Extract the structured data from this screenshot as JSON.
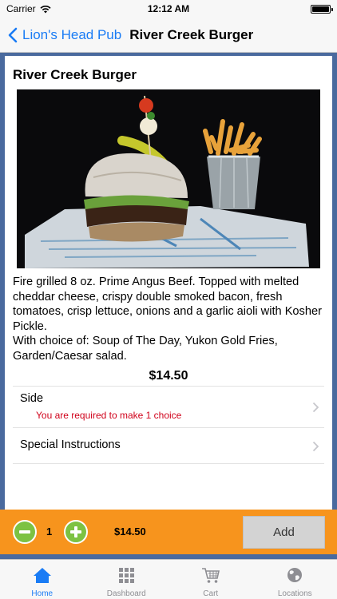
{
  "status_bar": {
    "carrier": "Carrier",
    "time": "12:12 AM"
  },
  "nav": {
    "back_label": "Lion's Head Pub",
    "title": "River Creek Burger"
  },
  "item": {
    "name": "River Creek Burger",
    "description_lines": [
      "Fire grilled 8 oz. Prime Angus Beef.  Topped with melted cheddar cheese, crispy double smoked bacon, fresh tomatoes, crisp lettuce, onions and a garlic aioli with Kosher Pickle.",
      "With choice of: Soup of The Day, Yukon Gold Fries, Garden/Caesar salad."
    ],
    "price": "$14.50"
  },
  "options": {
    "side_label": "Side",
    "side_warning": "You are required to make 1 choice",
    "special_label": "Special Instructions"
  },
  "order": {
    "quantity": "1",
    "total": "$14.50",
    "add_label": "Add"
  },
  "tabs": [
    {
      "label": "Home",
      "icon": "home-icon",
      "active": true
    },
    {
      "label": "Dashboard",
      "icon": "grid-icon",
      "active": false
    },
    {
      "label": "Cart",
      "icon": "cart-icon",
      "active": false
    },
    {
      "label": "Locations",
      "icon": "globe-icon",
      "active": false
    }
  ],
  "colors": {
    "accent": "#1a7cf5",
    "order_bar": "#f7941d",
    "quantity_button": "#7dc242",
    "warning": "#d0021b",
    "background": "#4a6a9e"
  }
}
